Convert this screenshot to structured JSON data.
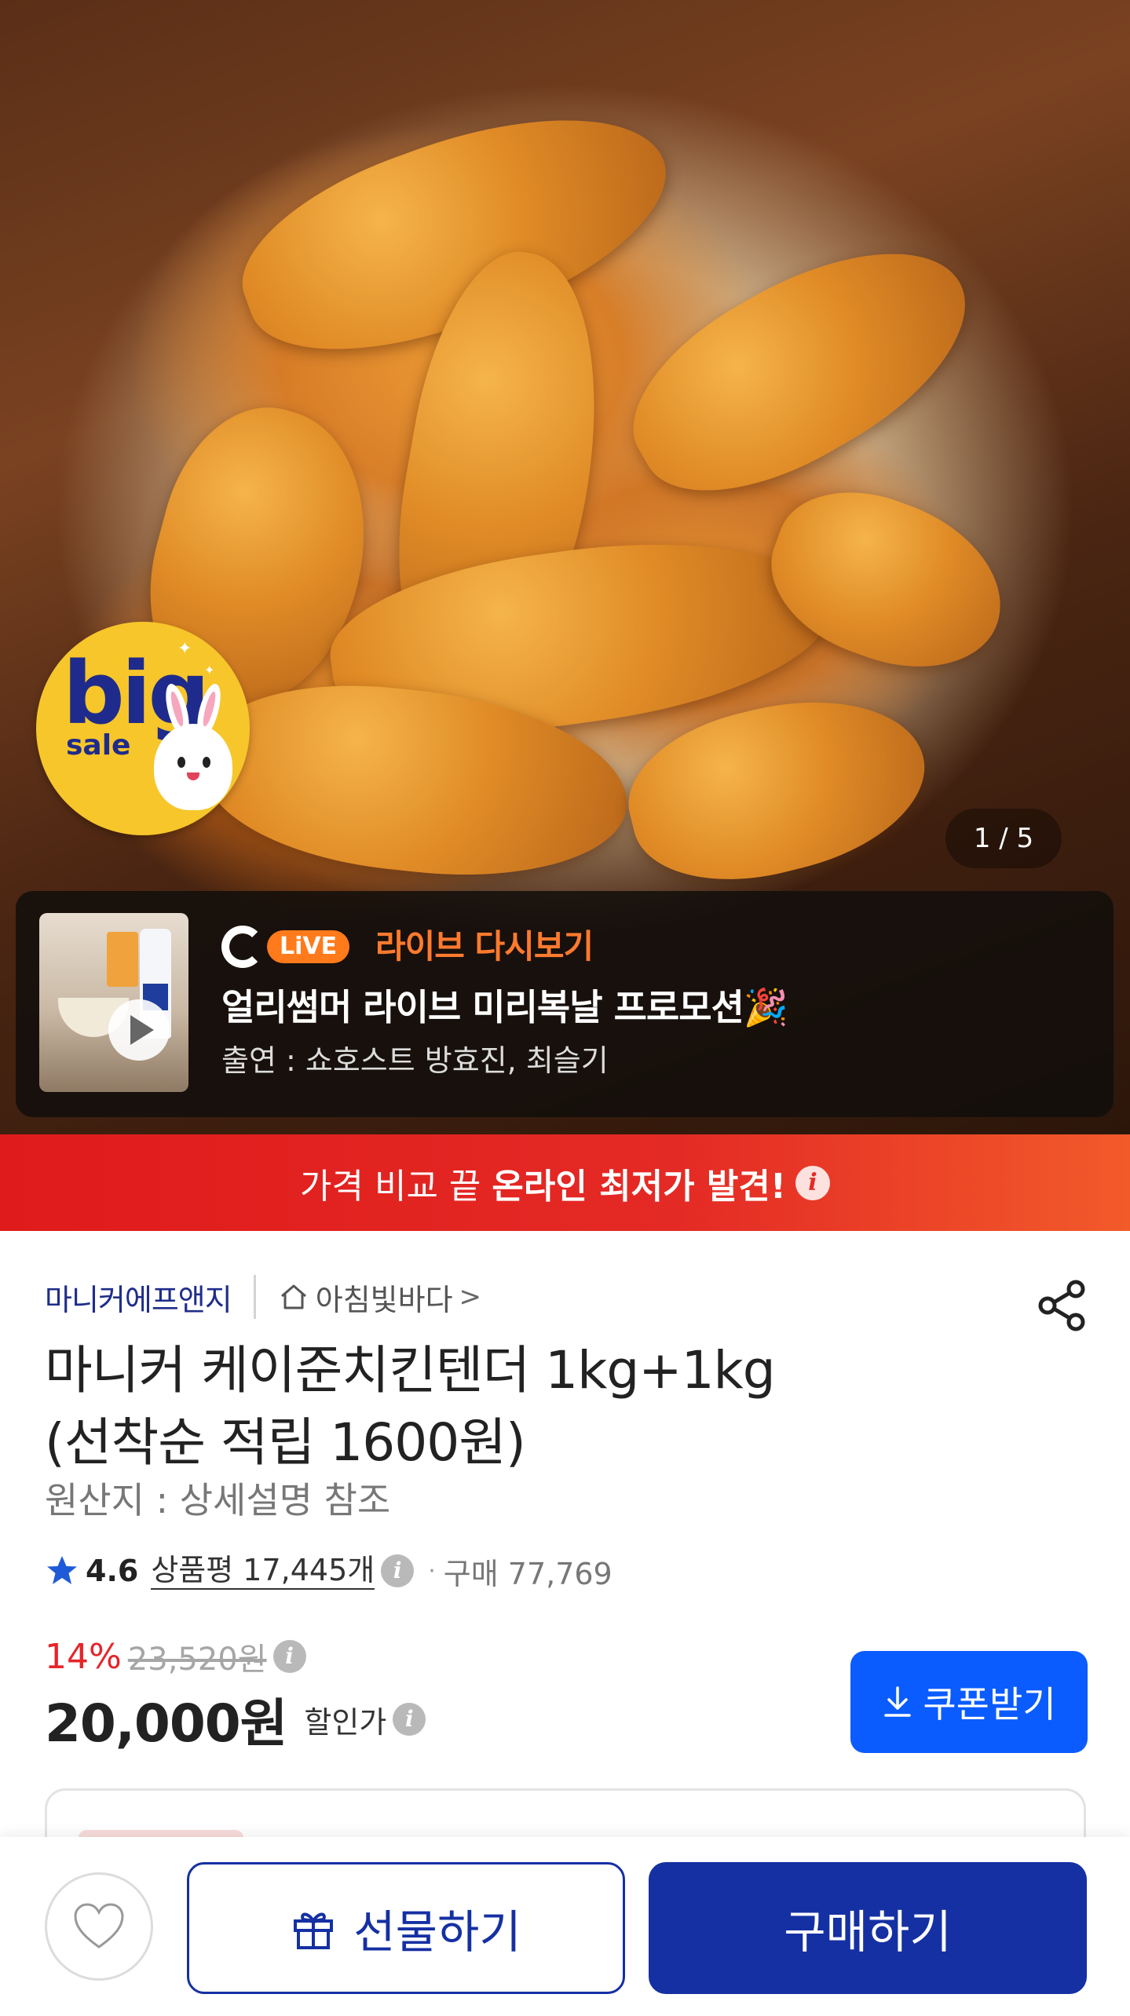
{
  "hero": {
    "badge": {
      "big": "big",
      "sale": "sale"
    },
    "page_indicator": "1 / 5"
  },
  "live": {
    "brand_pill": "LiVE",
    "replay_label": "라이브 다시보기",
    "title": "얼리썸머 라이브 미리복날 프로모션🎉",
    "cast": "출연 : 쇼호스트 방효진, 최슬기"
  },
  "price_banner": {
    "text": "가격 비교 끝",
    "highlight": "온라인 최저가 발견!",
    "info_icon": "i"
  },
  "product": {
    "seller": "마니커에프앤지",
    "store": "아침빛바다",
    "store_chevron": ">",
    "title_line1": "마니커 케이준치킨텐더 1kg+1kg",
    "title_line2": "(선착순 적립 1600원)",
    "origin": "원산지 : 상세설명 참조",
    "rating": "4.6",
    "reviews": "상품평 17,445개",
    "purchases": "구매 77,769",
    "discount": "14%",
    "original_price": "23,520원",
    "price": "20,000원",
    "price_label": "할인가",
    "info_icon": "i",
    "dot": "·"
  },
  "coupon": {
    "label": "쿠폰받기"
  },
  "bottom": {
    "gift_label": "선물하기",
    "buy_label": "구매하기"
  },
  "colors": {
    "brand_blue": "#1530a3",
    "coupon_blue": "#0b5cff",
    "sale_red": "#e5252a",
    "live_orange": "#ff7a2e"
  },
  "icons": [
    "home-icon",
    "share-icon",
    "star-icon",
    "info-icon",
    "download-icon",
    "heart-icon",
    "gift-icon",
    "play-icon"
  ]
}
